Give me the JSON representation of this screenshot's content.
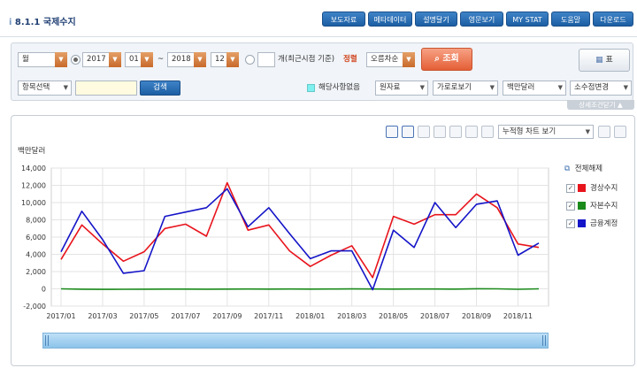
{
  "header": {
    "title": "8.1.1 국제수지",
    "buttons": [
      "보도자료",
      "메타데이터",
      "설명달기",
      "영문보기",
      "MY STAT",
      "도움말",
      "다운로드"
    ]
  },
  "filters": {
    "period_type": "월",
    "start_year": "2017",
    "start_month": "01",
    "range_sep": "~",
    "end_year": "2018",
    "end_month": "12",
    "recent_suffix": "개(최근시점 기준)",
    "sort_label": "정렬",
    "sort_value": "오름차순",
    "search_button": "조회",
    "table_button": "표",
    "item_select": "항목선택",
    "item_search_button": "검색",
    "no_data_label": "해당사항없음",
    "raw_data": "원자료",
    "horizontal_view": "가로로보기",
    "unit": "백만달러",
    "decimal": "소수점변경",
    "detail_toggle": "상세조건닫기"
  },
  "chart_toolbar": {
    "chart_view_select": "누적형 차트 보기"
  },
  "legend": {
    "toggle_all": "전체해제",
    "items": [
      {
        "label": "경상수지",
        "color": "#e8141c",
        "checked": true
      },
      {
        "label": "자본수지",
        "color": "#1a8a1a",
        "checked": true
      },
      {
        "label": "금융계정",
        "color": "#1414c8",
        "checked": true
      }
    ]
  },
  "chart_data": {
    "type": "line",
    "ylabel": "백만달러",
    "ylim": [
      -2000,
      14000
    ],
    "yticks": [
      "14,000",
      "12,000",
      "10,000",
      "8,000",
      "6,000",
      "4,000",
      "2,000",
      "0",
      "-2,000"
    ],
    "xtick_labels": [
      "2017/01",
      "2017/03",
      "2017/05",
      "2017/07",
      "2017/09",
      "2017/11",
      "2018/01",
      "2018/03",
      "2018/05",
      "2018/07",
      "2018/09",
      "2018/11"
    ],
    "x": [
      "2017/01",
      "2017/02",
      "2017/03",
      "2017/04",
      "2017/05",
      "2017/06",
      "2017/07",
      "2017/08",
      "2017/09",
      "2017/10",
      "2017/11",
      "2017/12",
      "2018/01",
      "2018/02",
      "2018/03",
      "2018/04",
      "2018/05",
      "2018/06",
      "2018/07",
      "2018/08",
      "2018/09",
      "2018/10",
      "2018/11",
      "2018/12"
    ],
    "grid": true,
    "series": [
      {
        "name": "경상수지",
        "color": "#e8141c",
        "values": [
          3400,
          7400,
          5200,
          3200,
          4300,
          7000,
          7500,
          6100,
          12300,
          6800,
          7400,
          4400,
          2600,
          3900,
          5000,
          1300,
          8400,
          7500,
          8600,
          8600,
          11000,
          9400,
          5200,
          4800
        ]
      },
      {
        "name": "자본수지",
        "color": "#1a8a1a",
        "values": [
          0,
          -40,
          -60,
          -50,
          -40,
          -30,
          -30,
          -40,
          -30,
          -20,
          -30,
          -20,
          -30,
          -20,
          -10,
          -20,
          -30,
          -20,
          -20,
          -30,
          10,
          0,
          -50,
          0
        ]
      },
      {
        "name": "금융계정",
        "color": "#1414c8",
        "values": [
          4300,
          9000,
          5700,
          1800,
          2100,
          8400,
          8900,
          9400,
          11600,
          7200,
          9400,
          6400,
          3500,
          4400,
          4400,
          -100,
          6800,
          4800,
          10000,
          7100,
          9800,
          10200,
          3900,
          5300
        ]
      }
    ]
  }
}
